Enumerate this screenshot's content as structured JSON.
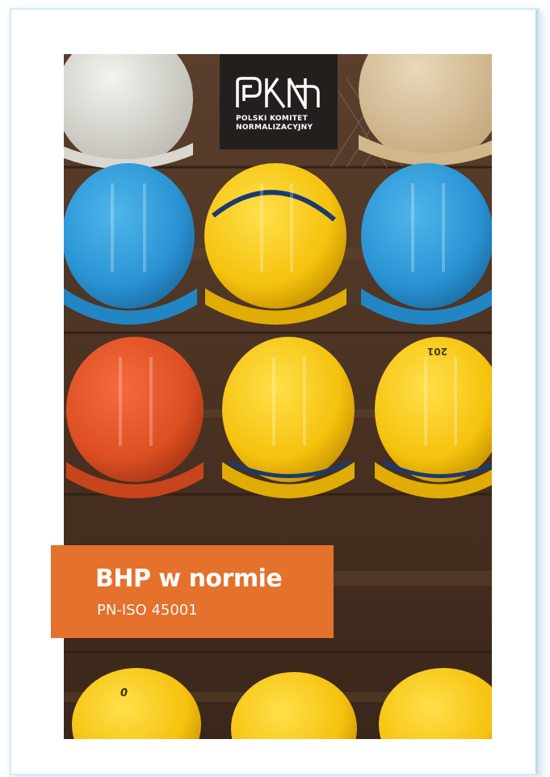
{
  "cover": {
    "photo_subject": "hard hats on wooden shelves",
    "logo": {
      "wordmark": "PKN",
      "line1": "POLSKI KOMITET",
      "line2": "NORMALIZACYJNY"
    },
    "title": "BHP w normie",
    "subtitle": "PN-ISO 45001",
    "accent_color": "#e4712c",
    "helmet_markings": [
      "201",
      "0"
    ]
  }
}
